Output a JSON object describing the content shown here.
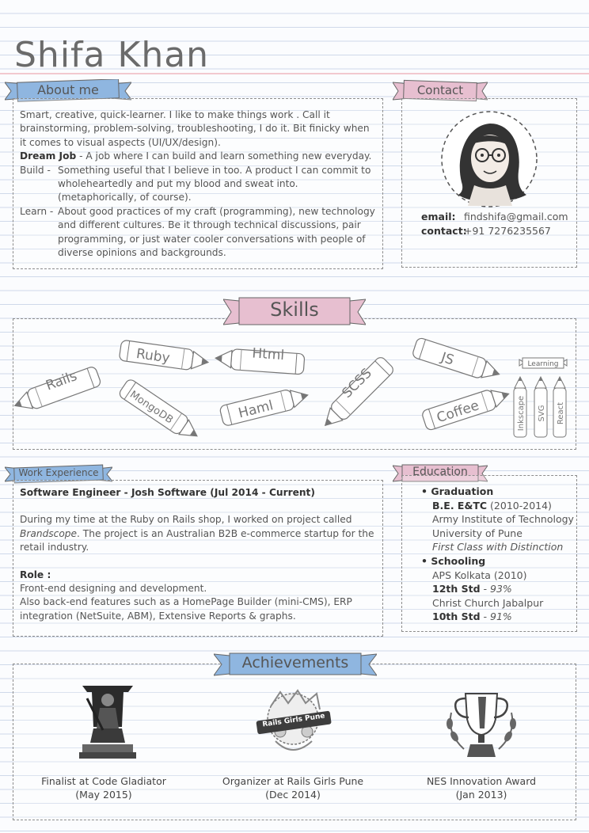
{
  "name": "Shifa Khan",
  "about": {
    "title": "About me",
    "intro": "Smart, creative, quick-learner. I like to make things work . Call it brainstorming, problem-solving, troubleshooting, I do it. Bit finicky when it comes to visual aspects (UI/UX/design).",
    "dream_job_label": "Dream Job",
    "dream_job_text": " - A job where I can build and learn something new everyday.",
    "build_label": "Build -",
    "build_text": "Something useful that I believe in too. A product I can commit to wholeheartedly and put my blood and sweat into. (metaphorically, of course).",
    "learn_label": "Learn -",
    "learn_text": "About good practices of my craft (programming), new technology and different cultures. Be it through technical discussions, pair programming, or just water cooler conversations with people of diverse opinions and backgrounds."
  },
  "contact": {
    "title": "Contact",
    "email_label": "email:",
    "email": "findshifa@gmail.com",
    "phone_label": "contact:",
    "phone": "+91 7276235567"
  },
  "skills": {
    "title": "Skills",
    "items": [
      "Ruby",
      "Html",
      "JS",
      "Rails",
      "MongoDB",
      "Haml",
      "SCSS",
      "Coffee"
    ],
    "learning_title": "Learning",
    "learning": [
      "Inkscape",
      "SVG",
      "React"
    ]
  },
  "work": {
    "title": "Work Experience",
    "position": "Software Engineer - Josh Software (Jul 2014 - Current)",
    "desc_pre": "During my time at the Ruby on Rails shop, I worked on project called ",
    "desc_italic": "Brandscope",
    "desc_post": ". The project is an Australian B2B e-commerce startup for the retail industry.",
    "role_label": "Role :",
    "role_1": "Front-end designing and development.",
    "role_2": "Also back-end features such as a HomePage Builder (mini-CMS), ERP integration (NetSuite, ABM), Extensive Reports & graphs."
  },
  "education": {
    "title": "Education",
    "grad_title": "Graduation",
    "grad_degree": "B.E. E&TC",
    "grad_years": " (2010-2014)",
    "grad_inst": "Army Institute of Technology",
    "grad_univ": "University of Pune",
    "grad_result": "First Class with Distinction",
    "school_title": "Schooling",
    "school_1": "APS Kolkata (2010)",
    "std12_label": "12th Std",
    "std12_score": "  - 93%",
    "school_2": "Christ Church Jabalpur",
    "std10_label": "10th Std",
    "std10_score": "  - 91%"
  },
  "achievements": {
    "title": "Achievements",
    "badge_text": "Rails Girls Pune",
    "items": [
      {
        "line1": "Finalist at Code Gladiator",
        "line2": "(May 2015)"
      },
      {
        "line1": "Organizer at Rails Girls Pune",
        "line2": "(Dec 2014)"
      },
      {
        "line1": "NES Innovation Award",
        "line2": "(Jan 2013)"
      }
    ]
  },
  "colors": {
    "blue_ribbon": "#8fb6e0",
    "pink_ribbon": "#e7bfd0",
    "ink": "#555555"
  }
}
